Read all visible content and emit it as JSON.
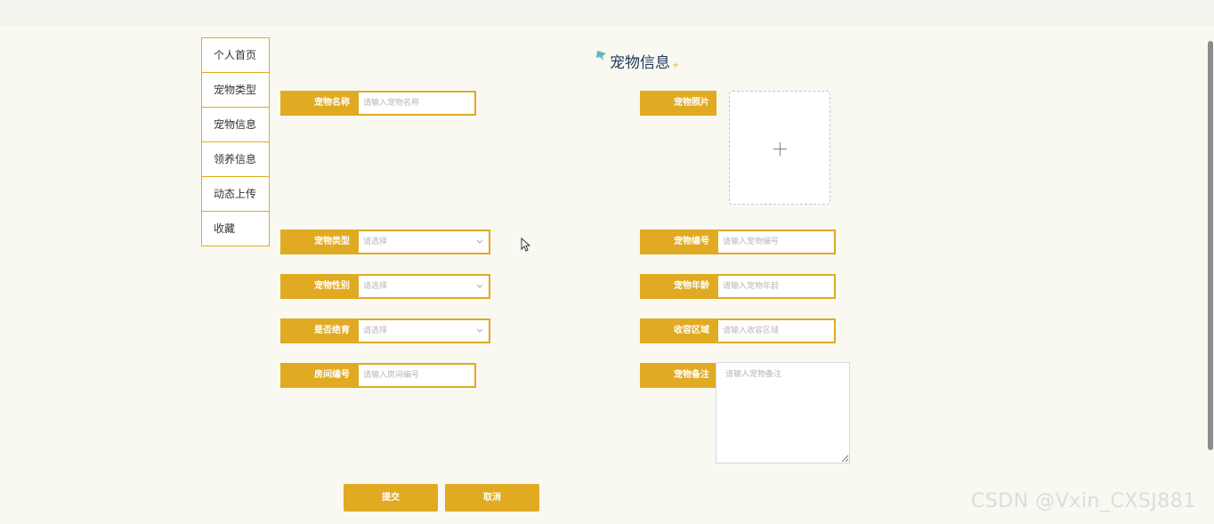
{
  "sidebar": {
    "items": [
      {
        "label": "个人首页"
      },
      {
        "label": "宠物类型"
      },
      {
        "label": "宠物信息"
      },
      {
        "label": "领养信息"
      },
      {
        "label": "动态上传"
      },
      {
        "label": "收藏"
      }
    ]
  },
  "page": {
    "title": "宠物信息"
  },
  "form": {
    "pet_name": {
      "label": "宠物名称",
      "placeholder": "请输入宠物名称"
    },
    "pet_photo": {
      "label": "宠物照片"
    },
    "pet_type": {
      "label": "宠物类型",
      "placeholder": "请选择"
    },
    "pet_number": {
      "label": "宠物编号",
      "placeholder": "请输入宠物编号"
    },
    "pet_gender": {
      "label": "宠物性别",
      "placeholder": "请选择"
    },
    "pet_age": {
      "label": "宠物年龄",
      "placeholder": "请输入宠物年龄"
    },
    "sterilized": {
      "label": "是否绝育",
      "placeholder": "请选择"
    },
    "shelter_area": {
      "label": "收容区域",
      "placeholder": "请输入收容区域"
    },
    "room_number": {
      "label": "房间编号",
      "placeholder": "请输入房间编号"
    },
    "pet_notes": {
      "label": "宠物备注",
      "placeholder": "请输入宠物备注"
    }
  },
  "actions": {
    "submit_label": "提交",
    "cancel_label": "取消"
  },
  "watermark": "CSDN @Vxin_CXSJ881",
  "colors": {
    "accent": "#e0aa22",
    "background": "#f9f8f1",
    "title": "#1d3a5c"
  },
  "icons": {
    "upload": "plus-icon",
    "select": "chevron-down-icon",
    "title_decor": "pin-icon"
  }
}
